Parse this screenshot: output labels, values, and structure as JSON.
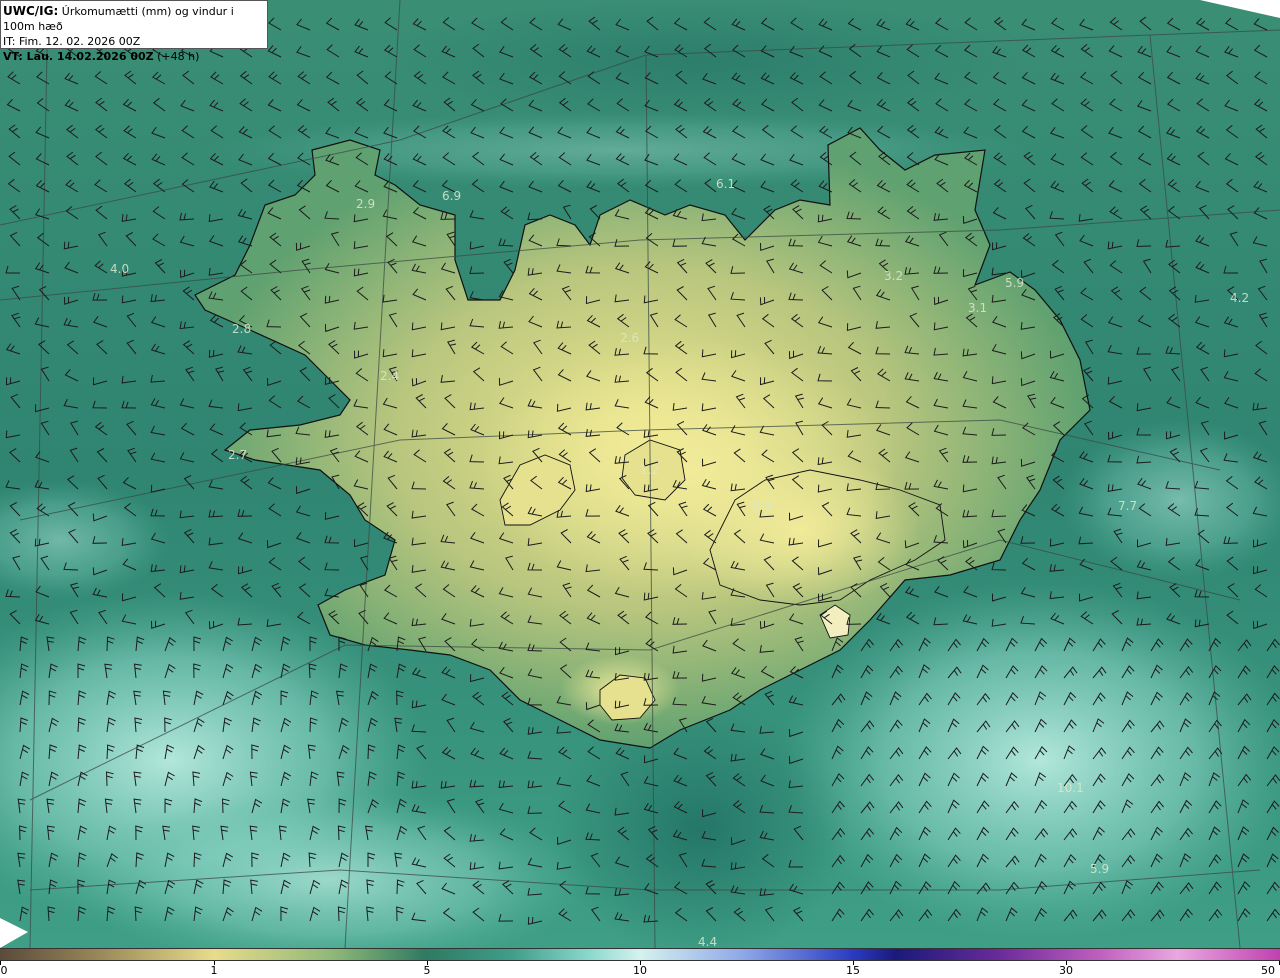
{
  "header": {
    "code": "UWC/IG:",
    "title": "Úrkomumætti (mm) og vindur i 100m hæð",
    "issue_time": "IT: Fim. 12. 02. 2026 00Z",
    "valid_prefix": "VT: ",
    "valid_time": "Lau. 14.02.2026 00Z",
    "valid_suffix": " (+48 h)"
  },
  "colorbar": {
    "labels": [
      "0",
      "1",
      "5",
      "10",
      "15",
      "30",
      "50"
    ]
  },
  "map_values": [
    "2.9",
    "6.9",
    "6.1",
    "4.0",
    "3.2",
    "5.9",
    "4.2",
    "3.1",
    "2.8",
    "2.6",
    "2.4",
    "2.7",
    "1.2",
    "0.9",
    "7.7",
    "10.1",
    "5.9",
    "4.4"
  ],
  "colors": {
    "sea": "#2f8a78",
    "land_low": "#4a9a72",
    "land_high": "#e8e28c",
    "coast": "#111111"
  }
}
